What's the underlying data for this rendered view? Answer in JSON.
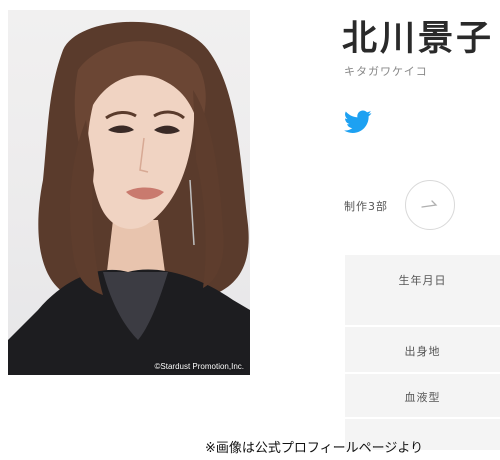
{
  "photo": {
    "credit": "©Stardust Promotion,Inc."
  },
  "profile": {
    "name": "北川景子",
    "name_kana": "キタガワケイコ",
    "social_icon": "twitter-bird-icon",
    "works_label": "制作3部",
    "works_button_icon": "arrow-icon",
    "fields": [
      "生年月日",
      "出身地",
      "血液型"
    ]
  },
  "caption": "※画像は公式プロフィールページより",
  "colors": {
    "twitter_blue": "#1da1f2",
    "panel_bg": "#f4f4f4",
    "name_text": "#2a2a2a"
  }
}
